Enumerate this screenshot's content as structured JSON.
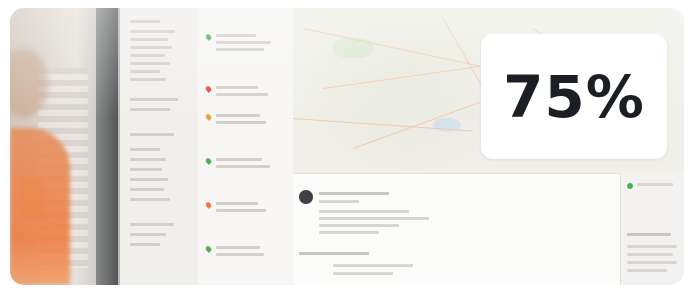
{
  "badge": {
    "value_text": "75%"
  }
}
